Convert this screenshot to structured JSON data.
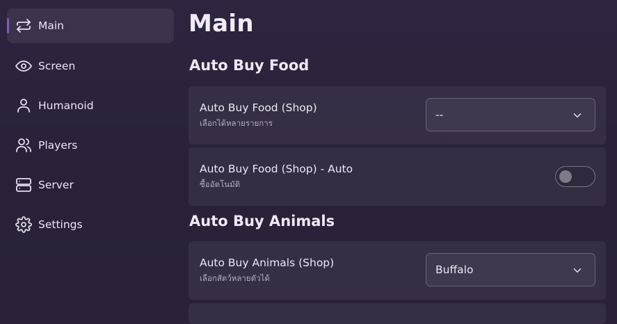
{
  "sidebar": {
    "items": [
      {
        "label": "Main",
        "icon": "swap-arrows-icon",
        "active": true
      },
      {
        "label": "Screen",
        "icon": "eye-icon",
        "active": false
      },
      {
        "label": "Humanoid",
        "icon": "user-icon",
        "active": false
      },
      {
        "label": "Players",
        "icon": "users-icon",
        "active": false
      },
      {
        "label": "Server",
        "icon": "server-icon",
        "active": false
      },
      {
        "label": "Settings",
        "icon": "gear-icon",
        "active": false
      }
    ]
  },
  "main": {
    "title": "Main",
    "sections": [
      {
        "title": "Auto Buy Food",
        "cards": [
          {
            "title": "Auto Buy Food (Shop)",
            "subtitle": "เลือกได้หลายรายการ",
            "control": "dropdown",
            "value": "--"
          },
          {
            "title": "Auto Buy Food (Shop) - Auto",
            "subtitle": "ซื้ออัตโนมัติ",
            "control": "toggle",
            "on": false
          }
        ]
      },
      {
        "title": "Auto Buy Animals",
        "cards": [
          {
            "title": "Auto Buy Animals (Shop)",
            "subtitle": "เลือกสัตว์หลายตัวได้",
            "control": "dropdown",
            "value": "Buffalo"
          }
        ]
      }
    ]
  },
  "colors": {
    "background": "#2b2239",
    "accent": "#7c5fb3",
    "card": "#3a3049",
    "text": "#ece6f3",
    "subtext": "#b6adc3"
  }
}
